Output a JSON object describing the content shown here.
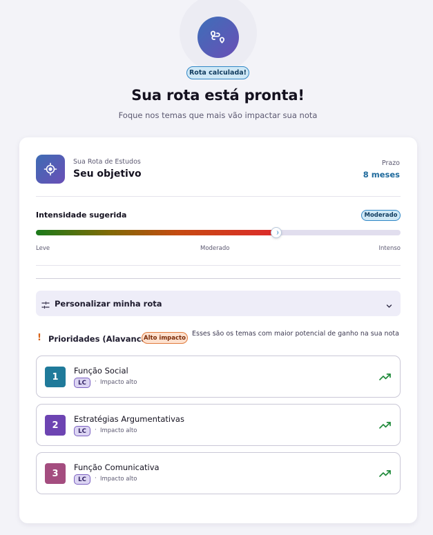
{
  "header": {
    "badge": "Rota calculada!",
    "title": "Sua rota está pronta!",
    "subtitle": "Foque nos temas que mais vão impactar sua nota"
  },
  "route": {
    "kicker": "Sua Rota de Estudos",
    "title": "Seu objetivo",
    "deadline_label": "Prazo",
    "deadline_value": "8 meses"
  },
  "intensity": {
    "label": "Intensidade sugerida",
    "badge": "Moderado",
    "level": 0.66,
    "scale": [
      "Leve",
      "Moderado",
      "Intenso"
    ]
  },
  "personalize": {
    "label": "Personalizar minha rota"
  },
  "priorities": {
    "title": "Prioridades (Alavancas)",
    "badge": "Alto impacto",
    "description": "Esses são os temas com maior potencial de ganho na sua nota",
    "items": [
      {
        "rank": "1",
        "title": "Função Social",
        "tag": "LC",
        "impact": "Impacto alto",
        "color": "#1f7a9a"
      },
      {
        "rank": "2",
        "title": "Estratégias Argumentativas",
        "tag": "LC",
        "impact": "Impacto alto",
        "color": "#6d44b2"
      },
      {
        "rank": "3",
        "title": "Função Comunicativa",
        "tag": "LC",
        "impact": "Impacto alto",
        "color": "#a44d7f"
      }
    ]
  },
  "colors": {
    "accent": "#5a5db7",
    "info_badge": "#cfe8f6",
    "trend_green": "#1f8a3a"
  }
}
